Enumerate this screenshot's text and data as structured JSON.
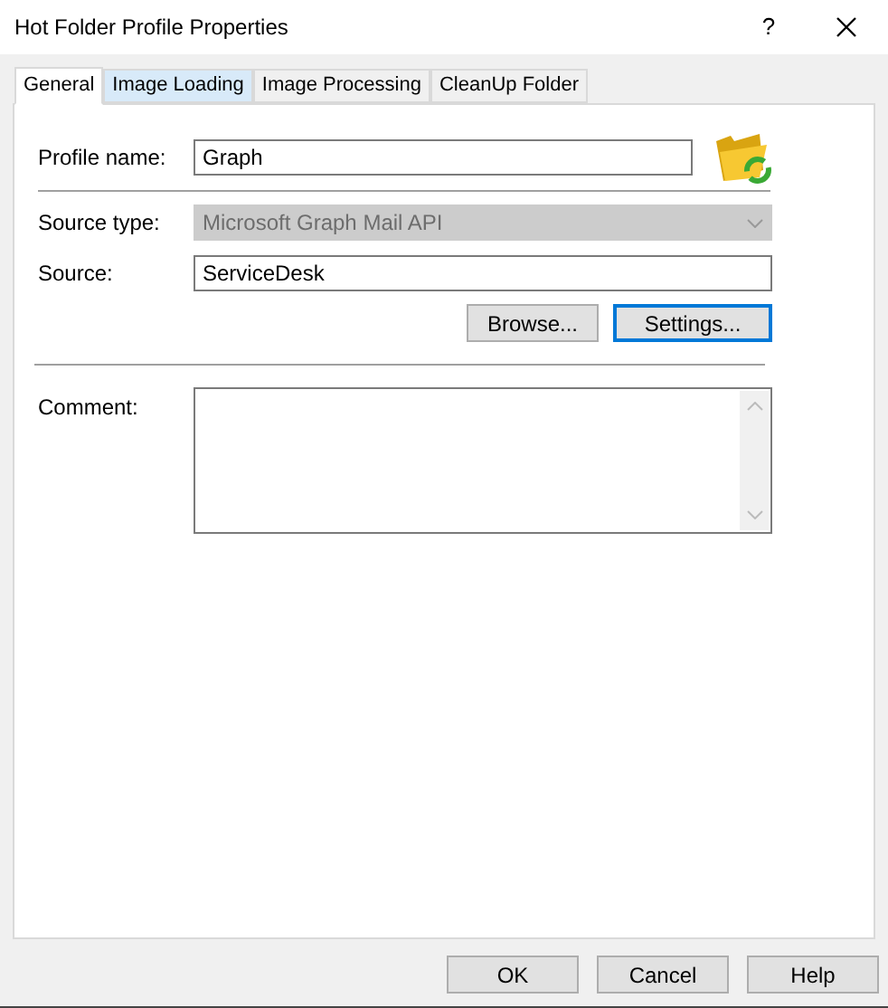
{
  "window": {
    "title": "Hot Folder Profile Properties",
    "help_button": "?"
  },
  "tabs": [
    {
      "label": "General",
      "selected": true,
      "highlighted": false
    },
    {
      "label": "Image Loading",
      "selected": false,
      "highlighted": true
    },
    {
      "label": "Image Processing",
      "selected": false,
      "highlighted": false
    },
    {
      "label": "CleanUp Folder",
      "selected": false,
      "highlighted": false
    }
  ],
  "profile_name": {
    "label": "Profile name:",
    "value": "Graph"
  },
  "source_type": {
    "label": "Source type:",
    "value": "Microsoft Graph Mail API",
    "disabled": true
  },
  "source": {
    "label": "Source:",
    "value": "ServiceDesk"
  },
  "source_buttons": [
    {
      "label": "Browse...",
      "focused": false
    },
    {
      "label": "Settings...",
      "focused": true
    }
  ],
  "comment": {
    "label": "Comment:"
  },
  "buttons": [
    "OK",
    "Cancel",
    "Help"
  ]
}
